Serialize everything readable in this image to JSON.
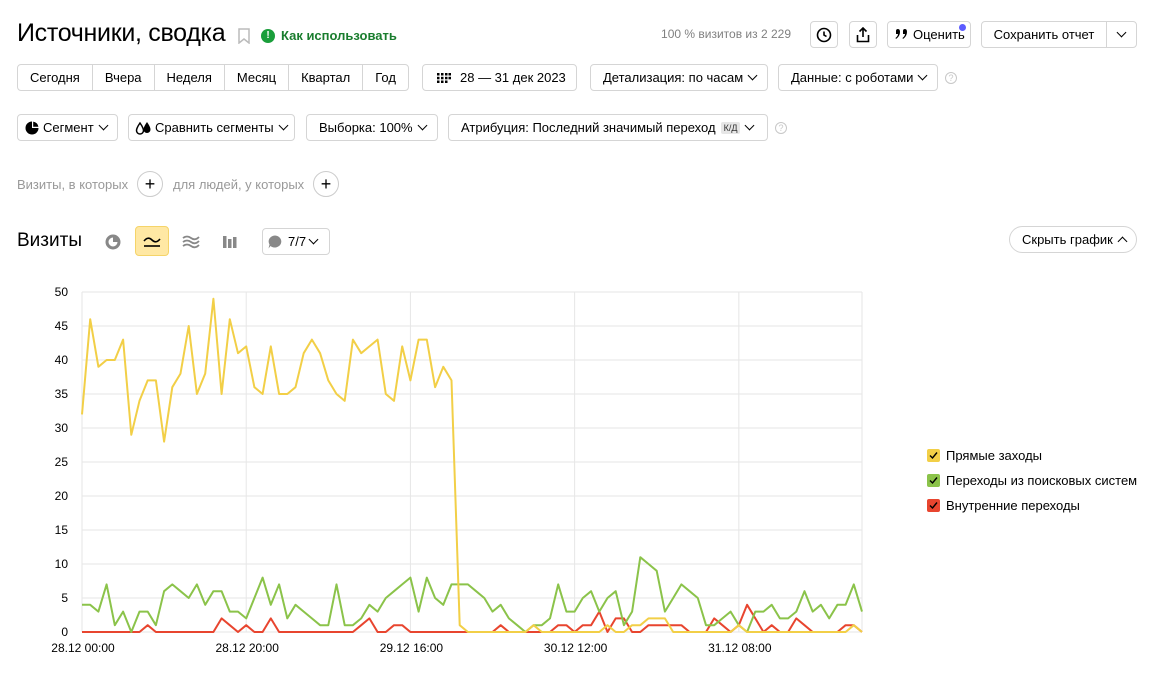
{
  "header": {
    "title": "Источники, сводка",
    "how_to_use": "Как использовать",
    "visits_info": "100 % визитов из 2 229",
    "rate_label": "Оценить",
    "save_report": "Сохранить отчет"
  },
  "toolbar": {
    "periods": [
      "Сегодня",
      "Вчера",
      "Неделя",
      "Месяц",
      "Квартал",
      "Год"
    ],
    "date_range": "28 — 31 дек 2023",
    "detail": "Детализация: по часам",
    "data_mode": "Данные: с роботами"
  },
  "segments": {
    "segment": "Сегмент",
    "compare": "Сравнить сегменты",
    "sample": "Выборка: 100%",
    "attribution": "Атрибуция: Последний значимый переход",
    "attribution_badge": "К/Д"
  },
  "filters": {
    "visits_label": "Визиты, в которых",
    "people_label": "для людей, у которых"
  },
  "chart_section": {
    "title": "Визиты",
    "series_toggle": "7/7",
    "hide_chart": "Скрыть график"
  },
  "colors": {
    "yellow": "#f2cf47",
    "green": "#8bc34a",
    "red": "#e8452f",
    "active_view": "#ffe8a4"
  },
  "chart_data": {
    "type": "line",
    "ylim": [
      0,
      50
    ],
    "yticks": [
      0,
      5,
      10,
      15,
      20,
      25,
      30,
      35,
      40,
      45,
      50
    ],
    "xticks": [
      "28.12 00:00",
      "28.12 20:00",
      "29.12 16:00",
      "30.12 12:00",
      "31.12 08:00"
    ],
    "xtick_hours": [
      0,
      20,
      40,
      60,
      80
    ],
    "hours": 96,
    "series": [
      {
        "name": "Прямые заходы",
        "color": "#f2cf47",
        "values": [
          32,
          46,
          39,
          40,
          40,
          43,
          29,
          34,
          37,
          37,
          28,
          36,
          38,
          45,
          35,
          38,
          49,
          35,
          46,
          41,
          42,
          36,
          35,
          42,
          35,
          35,
          36,
          41,
          43,
          41,
          37,
          35,
          34,
          43,
          41,
          42,
          43,
          35,
          34,
          42,
          37,
          43,
          43,
          36,
          39,
          37,
          1,
          0,
          0,
          0,
          0,
          0,
          0,
          0,
          0,
          1,
          0,
          0,
          0,
          0,
          0,
          0,
          0,
          0,
          1,
          0,
          0,
          1,
          1,
          2,
          2,
          2,
          0,
          0,
          0,
          0,
          0,
          0,
          0,
          0,
          1,
          0,
          0,
          0,
          0,
          0,
          0,
          0,
          0,
          0,
          0,
          0,
          0,
          0,
          1,
          0
        ]
      },
      {
        "name": "Переходы из поисковых систем",
        "color": "#8bc34a",
        "values": [
          4,
          4,
          3,
          7,
          1,
          3,
          0,
          3,
          3,
          1,
          6,
          7,
          6,
          5,
          7,
          4,
          6,
          6,
          3,
          3,
          2,
          5,
          8,
          4,
          7,
          2,
          4,
          3,
          2,
          1,
          1,
          7,
          1,
          1,
          2,
          4,
          3,
          5,
          6,
          7,
          8,
          3,
          8,
          5,
          4,
          7,
          7,
          7,
          6,
          5,
          3,
          4,
          2,
          1,
          0,
          1,
          1,
          2,
          7,
          3,
          3,
          5,
          6,
          3,
          5,
          6,
          1,
          3,
          11,
          10,
          9,
          3,
          5,
          7,
          6,
          5,
          1,
          1,
          2,
          3,
          1,
          0,
          3,
          3,
          4,
          2,
          2,
          3,
          6,
          3,
          4,
          2,
          4,
          4,
          7,
          3
        ]
      },
      {
        "name": "Внутренние переходы",
        "color": "#e8452f",
        "values": [
          0,
          0,
          0,
          0,
          0,
          0,
          0,
          0,
          1,
          0,
          0,
          0,
          0,
          0,
          0,
          0,
          0,
          2,
          1,
          0,
          1,
          0,
          0,
          2,
          0,
          0,
          0,
          0,
          0,
          0,
          0,
          0,
          0,
          0,
          1,
          2,
          0,
          0,
          1,
          1,
          0,
          0,
          0,
          0,
          0,
          0,
          0,
          0,
          0,
          0,
          0,
          1,
          0,
          0,
          0,
          0,
          0,
          0,
          1,
          1,
          0,
          1,
          1,
          3,
          0,
          2,
          2,
          0,
          0,
          1,
          1,
          1,
          1,
          1,
          0,
          0,
          0,
          2,
          1,
          0,
          1,
          4,
          2,
          0,
          1,
          0,
          0,
          2,
          1,
          0,
          0,
          0,
          0,
          1,
          1,
          0
        ]
      }
    ],
    "legend_position": "right",
    "grid": true
  }
}
